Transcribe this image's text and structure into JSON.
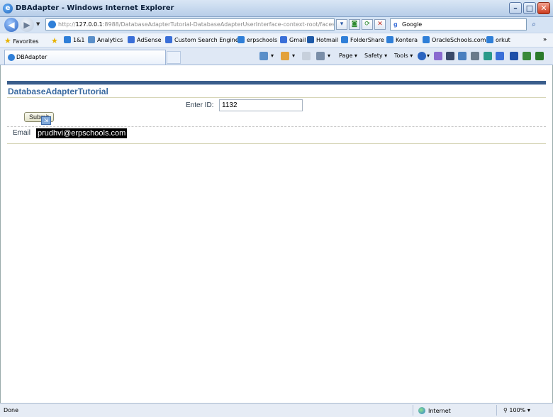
{
  "window": {
    "title": "DBAdapter - Windows Internet Explorer",
    "minimize": "–",
    "maximize": "□",
    "close": "✕"
  },
  "address": {
    "url_prefix": "http://",
    "url_host": "127.0.0.1",
    "url_rest": ":8988/DatabaseAdapterTutorial-DatabaseAdapterUserInterface-context-root/faces/Datab",
    "search_value": "Google"
  },
  "favorites": {
    "label": "Favorites",
    "items": [
      "1&1",
      "Analytics",
      "AdSense",
      "Custom Search Engine",
      "erpschools",
      "Gmail",
      "Hotmail",
      "FolderShare",
      "Kontera",
      "OracleSchools.com",
      "orkut"
    ],
    "more": "»"
  },
  "tab": {
    "label": "DBAdapter"
  },
  "toolbar": {
    "page": "Page ▾",
    "safety": "Safety ▾",
    "tools": "Tools ▾"
  },
  "page": {
    "title": "DatabaseAdapterTutorial",
    "enter_id_label": "Enter ID:",
    "enter_id_value": "1132",
    "submit_label": "Submit",
    "email_label": "Email",
    "email_value": "prudhvi@erpschools.com"
  },
  "status": {
    "left": "Done",
    "zone": "Internet",
    "zoom": "100%"
  },
  "colors": {
    "accent_bar": "#3b5e8c",
    "title_text": "#3a6aa0"
  }
}
